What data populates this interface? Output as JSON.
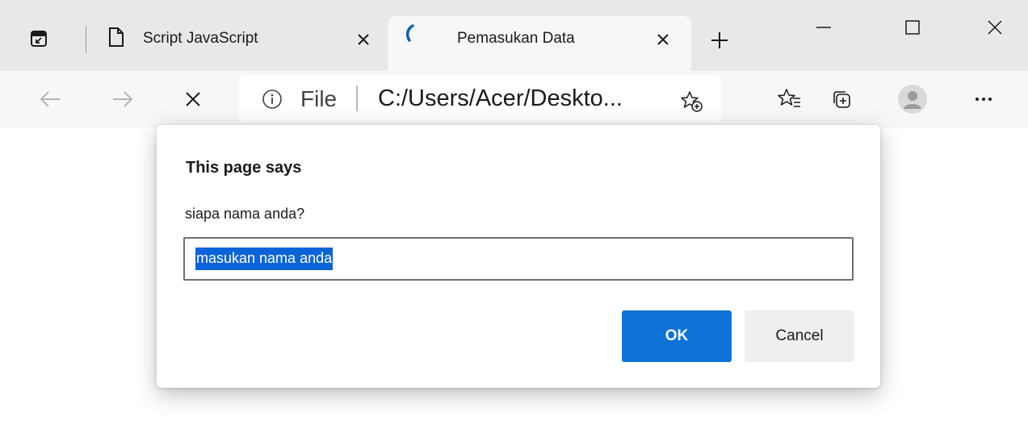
{
  "tabs": [
    {
      "title": "Script JavaScript",
      "icon": "page-icon",
      "active": false
    },
    {
      "title": "Pemasukan Data",
      "icon": "loading-spinner-icon",
      "active": true
    }
  ],
  "addressbar": {
    "scheme_label": "File",
    "url": "C:/Users/Acer/Deskto..."
  },
  "dialog": {
    "title": "This page says",
    "message": "siapa nama anda?",
    "input_value": "masukan nama anda",
    "ok_label": "OK",
    "cancel_label": "Cancel"
  },
  "colors": {
    "accent": "#0e72d6",
    "selection": "#0a63d8",
    "tabstrip": "#e8e8e8",
    "toolbar": "#f7f7f7"
  }
}
